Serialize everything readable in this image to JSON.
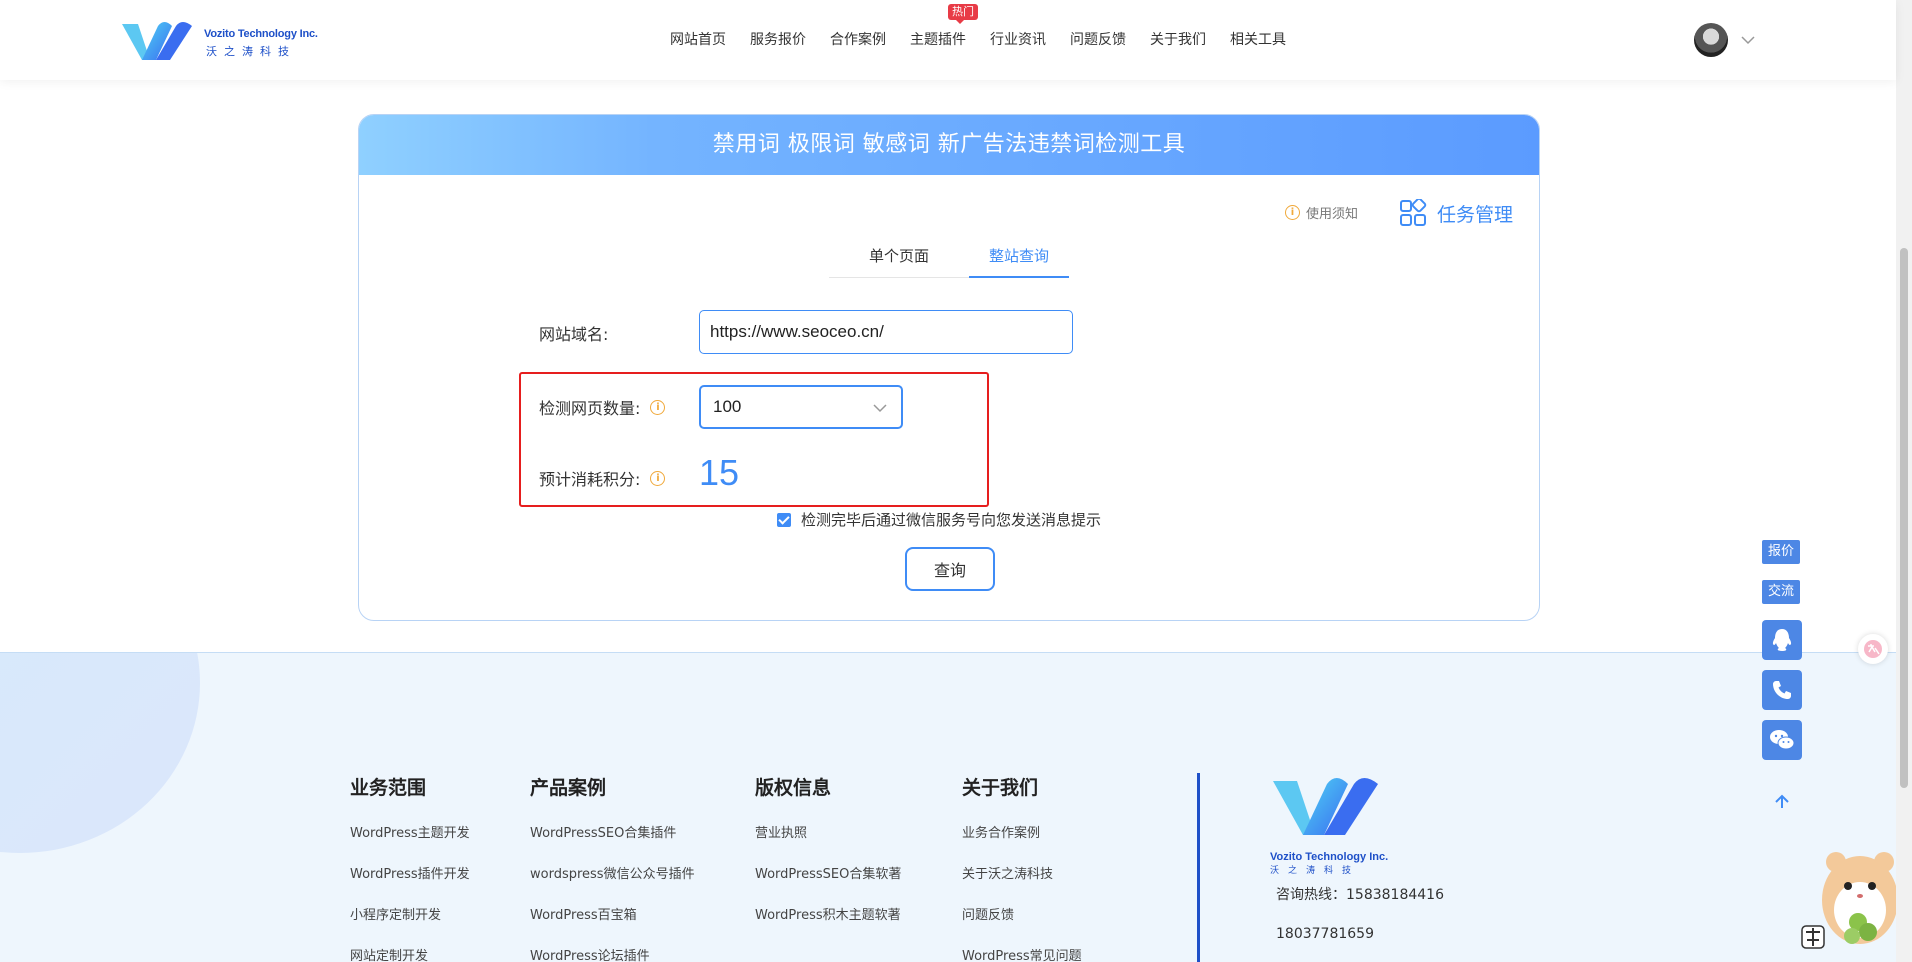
{
  "header": {
    "logo_en": "Vozito Technology Inc.",
    "logo_cn": "沃之涛科技",
    "nav": [
      {
        "label": "网站首页"
      },
      {
        "label": "服务报价"
      },
      {
        "label": "合作案例"
      },
      {
        "label": "主题插件",
        "badge": "热门"
      },
      {
        "label": "行业资讯"
      },
      {
        "label": "问题反馈"
      },
      {
        "label": "关于我们"
      },
      {
        "label": "相关工具"
      }
    ]
  },
  "tool": {
    "title": "禁用词 极限词 敏感词 新广告法违禁词检测工具",
    "notice_label": "使用须知",
    "task_label": "任务管理",
    "tabs": [
      {
        "label": "单个页面",
        "active": false
      },
      {
        "label": "整站查询",
        "active": true
      }
    ],
    "domain_label": "网站域名:",
    "domain_value": "https://www.seoceo.cn/",
    "count_label": "检测网页数量:",
    "count_value": "100",
    "points_label": "预计消耗积分:",
    "points_value": "15",
    "wechat_notify_label": "检测完毕后通过微信服务号向您发送消息提示",
    "wechat_notify_checked": true,
    "query_button": "查询"
  },
  "footer": {
    "columns": [
      {
        "title": "业务范围",
        "links": [
          "WordPress主题开发",
          "WordPress插件开发",
          "小程序定制开发",
          "网站定制开发"
        ]
      },
      {
        "title": "产品案例",
        "links": [
          "WordPressSEO合集插件",
          "wordspress微信公众号插件",
          "WordPress百宝箱",
          "WordPress论坛插件"
        ]
      },
      {
        "title": "版权信息",
        "links": [
          "营业执照",
          "WordPressSEO合集软著",
          "WordPress积木主题软著"
        ]
      },
      {
        "title": "关于我们",
        "links": [
          "业务合作案例",
          "关于沃之涛科技",
          "问题反馈",
          "WordPress常见问题"
        ]
      }
    ],
    "logo_en": "Vozito Technology Inc.",
    "logo_cn": "沃之涛科技",
    "hotline": "咨询热线：15838184416",
    "phone2": "18037781659"
  },
  "side": {
    "quote": "报价",
    "chat": "交流"
  },
  "colors": {
    "accent": "#3f8cf6",
    "highlight": "#e61e1e",
    "brand": "#1e50c8",
    "side": "#4d87e5"
  }
}
